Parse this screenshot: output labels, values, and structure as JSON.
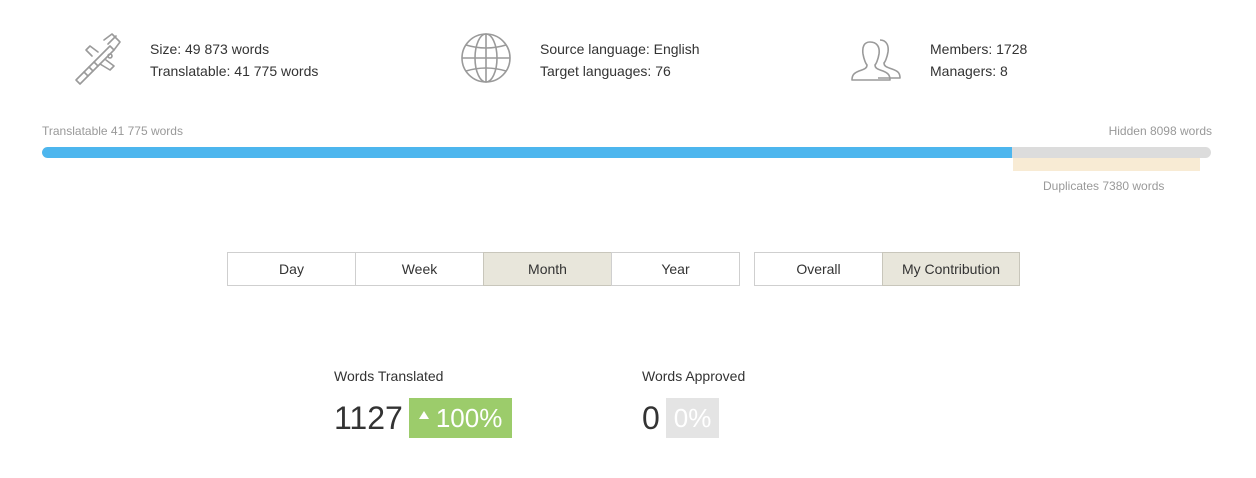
{
  "stats": {
    "size": {
      "icon": "caliper-icon",
      "size_line": "Size: 49 873 words",
      "translatable_line": "Translatable: 41 775 words"
    },
    "languages": {
      "icon": "globe-icon",
      "source_line": "Source language: English",
      "target_line": "Target languages: 76"
    },
    "team": {
      "icon": "users-icon",
      "members_line": "Members: 1728",
      "managers_line": "Managers: 8"
    }
  },
  "progress": {
    "translatable_label": "Translatable 41 775 words",
    "hidden_label": "Hidden 8098 words",
    "duplicates_label": "Duplicates 7380 words",
    "translatable_fraction": 0.83,
    "fill_color": "#4db6ee",
    "track_color": "#dcdcdc",
    "duplicates_color": "#f8ebd4"
  },
  "period_tabs": {
    "day": "Day",
    "week": "Week",
    "month": "Month",
    "year": "Year",
    "active": "Month"
  },
  "scope_tabs": {
    "overall": "Overall",
    "my_contribution": "My Contribution",
    "active": "My Contribution"
  },
  "metrics": {
    "translated": {
      "label": "Words Translated",
      "value": "1127",
      "change": "100%",
      "trend_icon": "triangle-up-icon",
      "badge_color": "#9ccc6b"
    },
    "approved": {
      "label": "Words Approved",
      "value": "0",
      "change": "0%",
      "badge_color": "#e4e4e4"
    }
  }
}
